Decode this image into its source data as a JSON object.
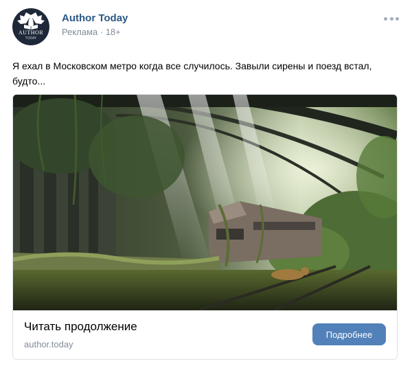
{
  "post": {
    "author": "Author Today",
    "meta": "Реклама · 18+",
    "text": "Я ехал в Московском метро когда все случилось. Завыли сирены и поезд встал, будто...",
    "avatar": {
      "title": "AUTHOR",
      "subtitle": "TODAY",
      "icon": "eagle-logo-icon"
    },
    "menu_icon": "more-dots-icon"
  },
  "card": {
    "title": "Читать продолжение",
    "domain": "author.today",
    "button_label": "Подробнее",
    "image": "overgrown-abandoned-subway-station-with-train"
  },
  "colors": {
    "link": "#2a5885",
    "muted": "#818c99",
    "button": "#5181b8",
    "border": "#dce1e6"
  }
}
